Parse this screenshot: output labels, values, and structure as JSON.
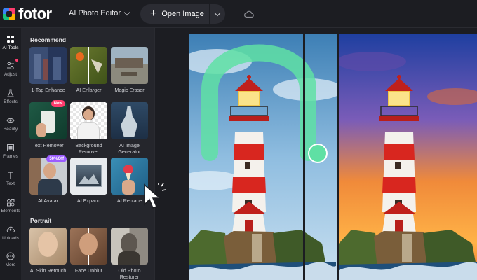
{
  "app": {
    "brand": "fotor"
  },
  "toolbar": {
    "ai_editor_label": "AI Photo Editor",
    "open_image_label": "Open Image"
  },
  "rail": {
    "items": [
      {
        "label": "AI Tools",
        "icon": "grid-icon"
      },
      {
        "label": "Adjust",
        "icon": "sliders-icon"
      },
      {
        "label": "Effects",
        "icon": "flask-icon"
      },
      {
        "label": "Beauty",
        "icon": "eye-icon"
      },
      {
        "label": "Frames",
        "icon": "frame-icon"
      },
      {
        "label": "Text",
        "icon": "text-icon"
      },
      {
        "label": "Elements",
        "icon": "shapes-icon"
      },
      {
        "label": "Uploads",
        "icon": "upload-icon"
      },
      {
        "label": "More",
        "icon": "more-icon"
      }
    ]
  },
  "panel": {
    "recommend_title": "Recommend",
    "portrait_title": "Portrait",
    "recommend_tools": [
      {
        "label": "1-Tap Enhance"
      },
      {
        "label": "AI Enlarger"
      },
      {
        "label": "Magic Eraser"
      },
      {
        "label": "Text Remover",
        "badge": "New"
      },
      {
        "label": "Background Remover"
      },
      {
        "label": "AI Image Generator"
      },
      {
        "label": "AI Avatar",
        "badge": "50%Off"
      },
      {
        "label": "AI Expand"
      },
      {
        "label": "AI Replace"
      }
    ],
    "portrait_tools": [
      {
        "label": "AI Skin Retouch"
      },
      {
        "label": "Face Unblur"
      },
      {
        "label": "Old Photo Restorer"
      }
    ]
  },
  "colors": {
    "accent": "#ff3d6e",
    "badge_new": "#ff3d6e",
    "badge_sale": "#9b5cff",
    "brush": "#5fe0a4"
  }
}
